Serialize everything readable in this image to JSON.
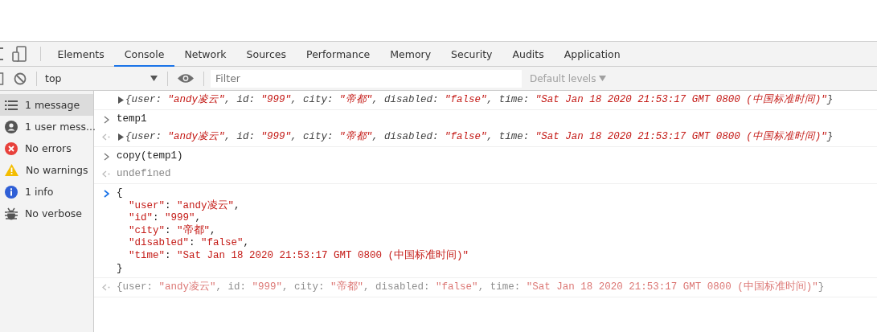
{
  "tabs": [
    {
      "label": "Elements",
      "selected": false
    },
    {
      "label": "Console",
      "selected": true
    },
    {
      "label": "Network",
      "selected": false
    },
    {
      "label": "Sources",
      "selected": false
    },
    {
      "label": "Performance",
      "selected": false
    },
    {
      "label": "Memory",
      "selected": false
    },
    {
      "label": "Security",
      "selected": false
    },
    {
      "label": "Audits",
      "selected": false
    },
    {
      "label": "Application",
      "selected": false
    }
  ],
  "toolbar": {
    "context": "top",
    "filter": {
      "placeholder": "Filter"
    },
    "levels": "Default levels"
  },
  "sidebar": {
    "items": [
      {
        "kind": "messages",
        "label": "1 message",
        "selected": true
      },
      {
        "kind": "user",
        "label": "1 user mess...",
        "selected": false
      },
      {
        "kind": "error",
        "label": "No errors",
        "selected": false
      },
      {
        "kind": "warning",
        "label": "No warnings",
        "selected": false
      },
      {
        "kind": "info",
        "label": "1 info",
        "selected": false
      },
      {
        "kind": "verbose",
        "label": "No verbose",
        "selected": false
      }
    ]
  },
  "messages": [
    {
      "kind": "log",
      "expandable": true,
      "italic": true,
      "dimmed": false,
      "lines": [
        [
          {
            "text": "{user: ",
            "kind": "key"
          },
          {
            "text": "\"andy凌云\"",
            "kind": "string"
          },
          {
            "text": ", id: ",
            "kind": "key"
          },
          {
            "text": "\"999\"",
            "kind": "string"
          },
          {
            "text": ", city: ",
            "kind": "key"
          },
          {
            "text": "\"帝都\"",
            "kind": "string"
          },
          {
            "text": ", disabled: ",
            "kind": "key"
          },
          {
            "text": "\"false\"",
            "kind": "string"
          },
          {
            "text": ", time: ",
            "kind": "key"
          },
          {
            "text": "\"Sat Jan 18 2020 21:53:17 GMT 0800 (中国标准时间)\"",
            "kind": "string"
          },
          {
            "text": "}",
            "kind": "key"
          }
        ]
      ]
    },
    {
      "kind": "input",
      "expandable": false,
      "italic": false,
      "dimmed": false,
      "lines": [
        [
          {
            "text": "temp1",
            "kind": "plain"
          }
        ]
      ]
    },
    {
      "kind": "output",
      "expandable": true,
      "italic": true,
      "dimmed": false,
      "lines": [
        [
          {
            "text": "{user: ",
            "kind": "key"
          },
          {
            "text": "\"andy凌云\"",
            "kind": "string"
          },
          {
            "text": ", id: ",
            "kind": "key"
          },
          {
            "text": "\"999\"",
            "kind": "string"
          },
          {
            "text": ", city: ",
            "kind": "key"
          },
          {
            "text": "\"帝都\"",
            "kind": "string"
          },
          {
            "text": ", disabled: ",
            "kind": "key"
          },
          {
            "text": "\"false\"",
            "kind": "string"
          },
          {
            "text": ", time: ",
            "kind": "key"
          },
          {
            "text": "\"Sat Jan 18 2020 21:53:17 GMT 0800 (中国标准时间)\"",
            "kind": "string"
          },
          {
            "text": "}",
            "kind": "key"
          }
        ]
      ]
    },
    {
      "kind": "input",
      "expandable": false,
      "italic": false,
      "dimmed": false,
      "lines": [
        [
          {
            "text": "copy(temp1)",
            "kind": "plain"
          }
        ]
      ]
    },
    {
      "kind": "output",
      "expandable": false,
      "italic": false,
      "dimmed": false,
      "lines": [
        [
          {
            "text": "undefined",
            "kind": "muted"
          }
        ]
      ]
    },
    {
      "kind": "prompt",
      "expandable": false,
      "italic": false,
      "dimmed": false,
      "lines": [
        [
          {
            "text": "{",
            "kind": "plain"
          }
        ],
        [
          {
            "text": "  \"user\"",
            "kind": "string"
          },
          {
            "text": ": ",
            "kind": "plain"
          },
          {
            "text": "\"andy凌云\"",
            "kind": "string"
          },
          {
            "text": ",",
            "kind": "plain"
          }
        ],
        [
          {
            "text": "  \"id\"",
            "kind": "string"
          },
          {
            "text": ": ",
            "kind": "plain"
          },
          {
            "text": "\"999\"",
            "kind": "string"
          },
          {
            "text": ",",
            "kind": "plain"
          }
        ],
        [
          {
            "text": "  \"city\"",
            "kind": "string"
          },
          {
            "text": ": ",
            "kind": "plain"
          },
          {
            "text": "\"帝都\"",
            "kind": "string"
          },
          {
            "text": ",",
            "kind": "plain"
          }
        ],
        [
          {
            "text": "  \"disabled\"",
            "kind": "string"
          },
          {
            "text": ": ",
            "kind": "plain"
          },
          {
            "text": "\"false\"",
            "kind": "string"
          },
          {
            "text": ",",
            "kind": "plain"
          }
        ],
        [
          {
            "text": "  \"time\"",
            "kind": "string"
          },
          {
            "text": ": ",
            "kind": "plain"
          },
          {
            "text": "\"Sat Jan 18 2020 21:53:17 GMT 0800 (中国标准时间)\"",
            "kind": "string"
          }
        ],
        [
          {
            "text": "}",
            "kind": "plain"
          }
        ]
      ]
    },
    {
      "kind": "output",
      "expandable": false,
      "italic": false,
      "dimmed": true,
      "lines": [
        [
          {
            "text": "{user: ",
            "kind": "key"
          },
          {
            "text": "\"andy凌云\"",
            "kind": "string"
          },
          {
            "text": ", id: ",
            "kind": "key"
          },
          {
            "text": "\"999\"",
            "kind": "string"
          },
          {
            "text": ", city: ",
            "kind": "key"
          },
          {
            "text": "\"帝都\"",
            "kind": "string"
          },
          {
            "text": ", disabled: ",
            "kind": "key"
          },
          {
            "text": "\"false\"",
            "kind": "string"
          },
          {
            "text": ", time: ",
            "kind": "key"
          },
          {
            "text": "\"Sat Jan 18 2020 21:53:17 GMT 0800 (中国标准时间)\"",
            "kind": "string"
          },
          {
            "text": "}",
            "kind": "key"
          }
        ]
      ]
    }
  ]
}
